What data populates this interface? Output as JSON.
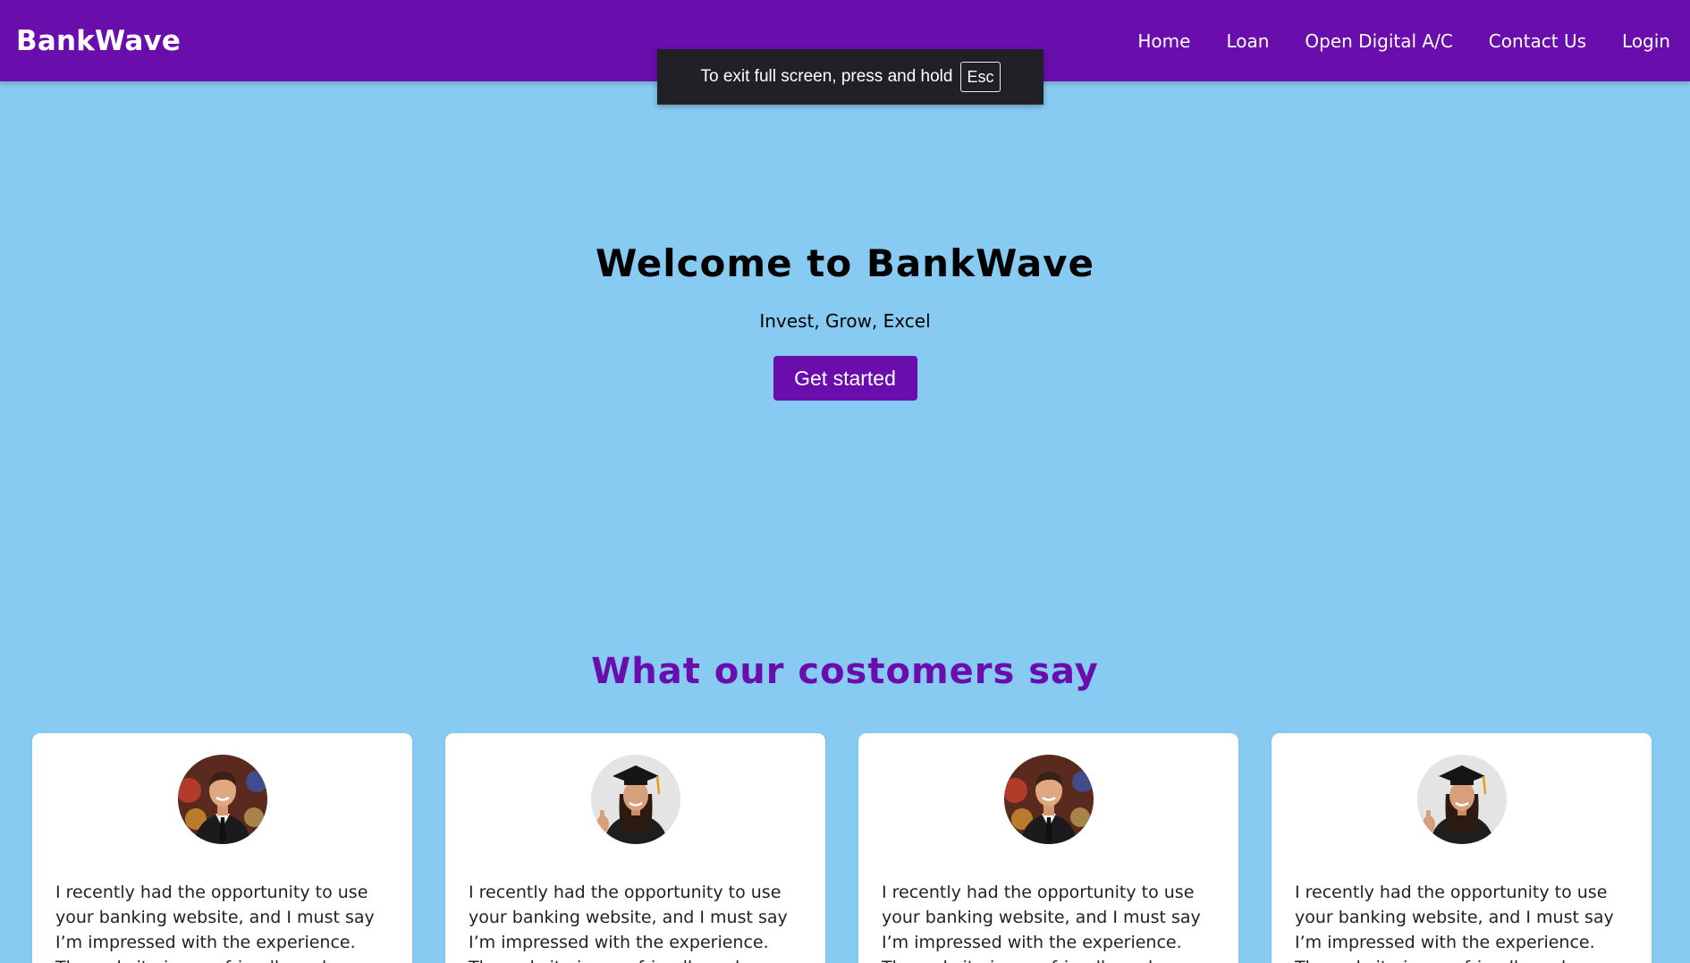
{
  "navbar": {
    "brand": "BankWave",
    "links": [
      "Home",
      "Loan",
      "Open Digital A/C",
      "Contact Us",
      "Login"
    ],
    "color": "#6a0dad"
  },
  "toast": {
    "text": "To exit full screen, press and hold",
    "key": "Esc"
  },
  "hero": {
    "title": "Welcome to BankWave",
    "subtitle": "Invest, Grow, Excel",
    "cta_label": "Get started"
  },
  "testimonials": {
    "title": "What our costomers say",
    "cards": [
      {
        "avatar": "man-in-suit-avatar",
        "text": "I recently had the opportunity to use your banking website, and I must say I’m impressed with the experience. The website is user-friendly and easy to navigate."
      },
      {
        "avatar": "graduate-woman-avatar",
        "text": "I recently had the opportunity to use your banking website, and I must say I’m impressed with the experience. The website is user-friendly and easy to navigate."
      },
      {
        "avatar": "man-in-suit-avatar",
        "text": "I recently had the opportunity to use your banking website, and I must say I’m impressed with the experience. The website is user-friendly and easy to navigate."
      },
      {
        "avatar": "graduate-woman-avatar",
        "text": "I recently had the opportunity to use your banking website, and I must say I’m impressed with the experience. The website is user-friendly and easy to navigate."
      }
    ]
  },
  "colors": {
    "background": "#87cbf3",
    "accent": "#6a0dad"
  }
}
